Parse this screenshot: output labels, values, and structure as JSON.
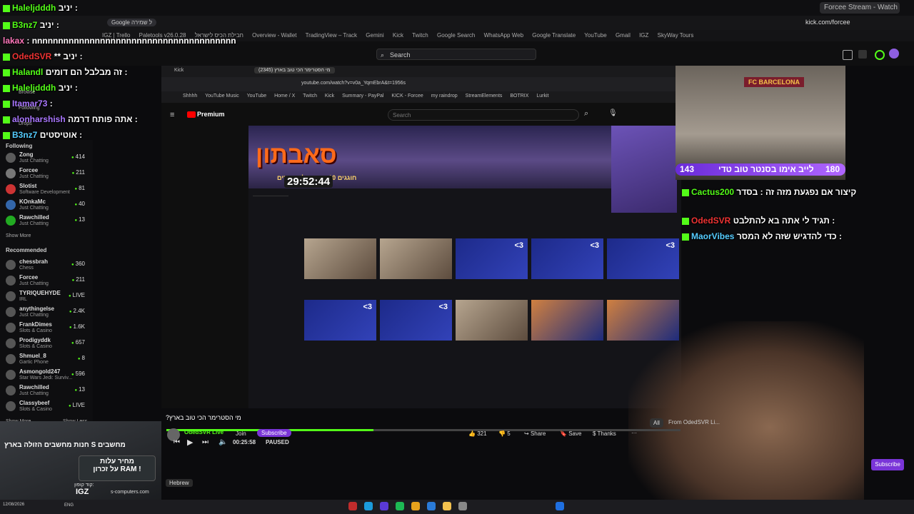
{
  "browser": {
    "tabs": [
      "Forcee Stream - Watch Live on",
      "kick.com/forcee"
    ],
    "address": "kick.com/forcee",
    "bookmarks": [
      "IGZ | Trello",
      "Paletools v26.0.28",
      "חבילת הכיס לישראל",
      "Overview - Wallet",
      "TradingView – Track",
      "Gemini",
      "Kick",
      "Twitch",
      "Google Search",
      "WhatsApp Web",
      "Google Translate",
      "YouTube",
      "Gmail",
      "IGZ",
      "SkyWay Tours"
    ],
    "google_btn": "Google ל שמירה"
  },
  "kick": {
    "search_placeholder": "Search"
  },
  "chat_overlay": [
    {
      "user": "Haleljdddh",
      "msg": "יניב :"
    },
    {
      "user": "B3nz7",
      "msg": "יניב :"
    },
    {
      "user": "lakax",
      "msg": ": nnnnnnnnnnnnnnnnnnnnnnnnnnnnnnnnnnnnnnn"
    },
    {
      "user": "OdedSVR",
      "msg": "** יניב :"
    },
    {
      "user": "Halandl",
      "msg": "זה מבלבל הם דומים :"
    },
    {
      "user": "Haleljdddh",
      "msg": "יניב :"
    },
    {
      "user": "Itamar73",
      "msg": ":"
    },
    {
      "user": "alonharshish",
      "msg": "אתה פותח דרמה :"
    },
    {
      "user": "B3nz7",
      "msg": "אוטיסטים :"
    }
  ],
  "sidebar": {
    "browse": "Browse",
    "following_label": "Following",
    "drops": "Drops",
    "following_head": "Following",
    "following": [
      {
        "name": "Zong",
        "cat": "Just Chatting",
        "count": "414"
      },
      {
        "name": "Forcee",
        "cat": "Just Chatting",
        "count": "211"
      },
      {
        "name": "Slotist",
        "cat": "Software Development",
        "count": "81"
      },
      {
        "name": "KOnkaMc",
        "cat": "Just Chatting",
        "count": "40"
      },
      {
        "name": "Rawchilled",
        "cat": "Just Chatting",
        "count": "13"
      }
    ],
    "show_more": "Show More",
    "recommended_head": "Recommended",
    "recommended": [
      {
        "name": "chessbrah",
        "cat": "Chess",
        "count": "360"
      },
      {
        "name": "Forcee",
        "cat": "Just Chatting",
        "count": "211"
      },
      {
        "name": "TYRIQUEHYDE",
        "cat": "IRL",
        "count": "LIVE"
      },
      {
        "name": "anythingelse",
        "cat": "Just Chatting",
        "count": "2.4K"
      },
      {
        "name": "FrankDimes",
        "cat": "Slots & Casino",
        "count": "1.6K"
      },
      {
        "name": "Prodigyddk",
        "cat": "Slots & Casino",
        "count": "657"
      },
      {
        "name": "Shmuel_8",
        "cat": "Gartic Phone",
        "count": "8"
      },
      {
        "name": "Asmongold247",
        "cat": "Star Wars Jedi: Surviv...",
        "count": "596"
      },
      {
        "name": "Rawchilled",
        "cat": "Just Chatting",
        "count": "13"
      },
      {
        "name": "Classybeef",
        "cat": "Slots & Casino",
        "count": "LIVE"
      }
    ],
    "show_more2": "Show More",
    "show_less": "Show Less"
  },
  "inner_browser": {
    "tab1": "Kick",
    "tab2": "מי הסטרימר הכי טוב בארץ (2345)",
    "address": "youtube.com/watch?v=v0a_YqmEbrA&t=1956s",
    "bookmarks": [
      "Shhhh",
      "YouTube Music",
      "YouTube",
      "Home / X",
      "Twitch",
      "Kick",
      "Summary - PayPal",
      "KICK - Forcee",
      "my raindrop",
      "StreamElements",
      "BOTRIX",
      "Lurkit"
    ]
  },
  "youtube": {
    "logo": "Premium",
    "search_placeholder": "Search",
    "timer": "29:52:44",
    "banner_title": "סאבתון",
    "banner_sub": "חוגגים 10 שנים של שידורים",
    "video_title": "?מי הסטרימר הכי טוב בארץ",
    "channel": "OdedSVR Live",
    "join": "Join",
    "subscribe": "Subscribe",
    "time": "00:25:58",
    "paused": "PAUSED",
    "likes": "321",
    "dislikes": "5",
    "share": "Share",
    "save": "Save",
    "thanks": "Thanks",
    "chip_all": "All",
    "chip_from": "From OdedSVR Li...",
    "video_hearts": [
      "<3",
      "<3",
      "<3",
      "<3",
      "<3"
    ]
  },
  "cam_overlay": {
    "label": "לייב אימו בסנטר טוב טדי",
    "left_num": "143",
    "right_num": "180",
    "flag": "FC BARCELONA",
    "chat": [
      {
        "user": "Cactus200",
        "msg": "קיצור אם נפגעת מזה זה : בסדר"
      },
      {
        "user": "OdedSVR",
        "msg": "תגיד לי אתה בא להתלבט :"
      },
      {
        "user": "MaorVibes",
        "msg": "כדי להדגיש שזה לא המסר :"
      }
    ]
  },
  "promo": {
    "title": "חנות מחשבים הזולה בארץ",
    "brand": "S מחשבים",
    "line1": "מחיר עלות",
    "line2": "על זכרון RAM !",
    "code_label": "קוד קופון:",
    "code": "IGZ",
    "site": "s-computers.com"
  },
  "language": "Hebrew",
  "subscribe_btn": "Subscribe",
  "taskbar": {
    "date": "12/08/2026",
    "lang": "ENG"
  },
  "colors": {
    "kick_green": "#53fc18",
    "bar_purple": "#8a3cf0",
    "yt_red": "#ff0000"
  }
}
